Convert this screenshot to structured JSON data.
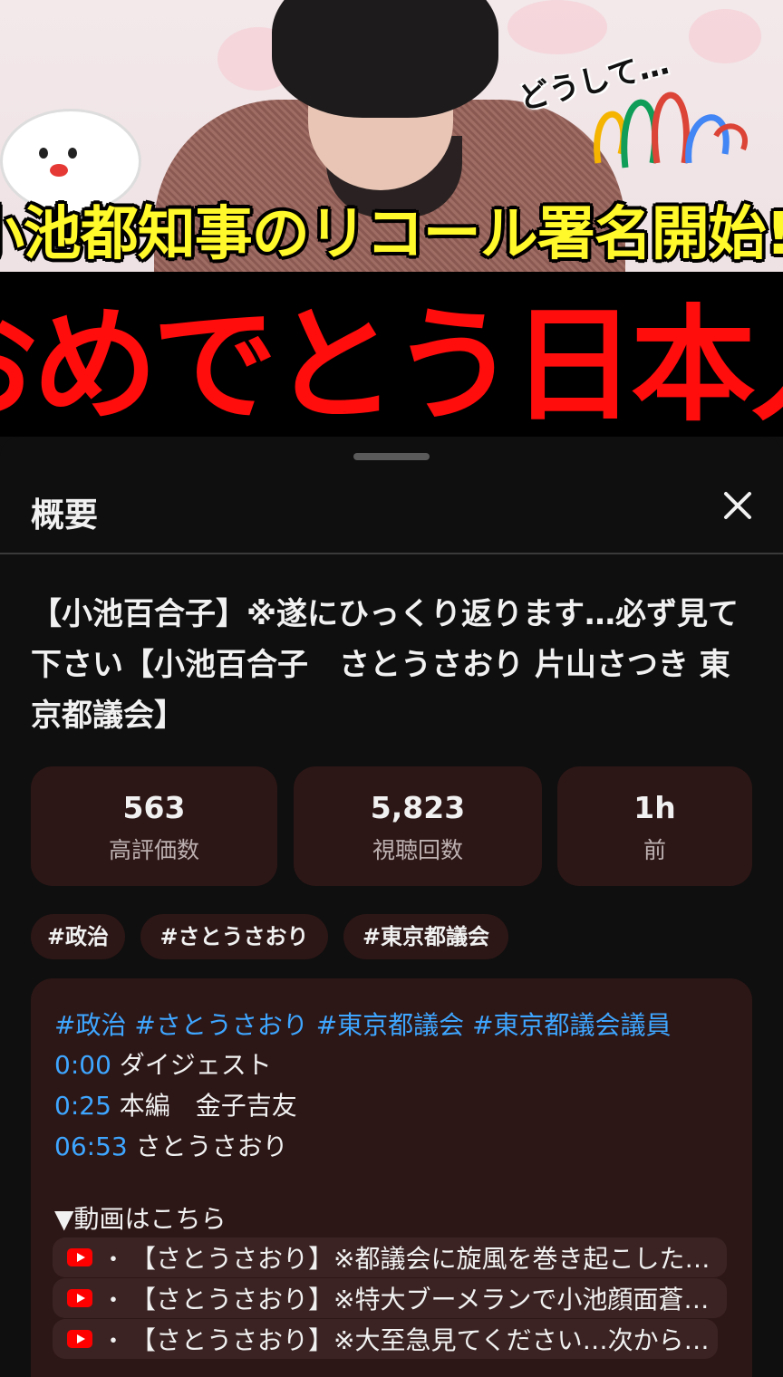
{
  "thumbnail": {
    "caption_top": "小池都知事のリコール署名開始!!",
    "caption_bottom": "おめでとう日本人",
    "bubble_text": "どうして…"
  },
  "sheet": {
    "title": "概要",
    "close_icon": "close-icon"
  },
  "video": {
    "title": "【小池百合子】※遂にひっくり返ります…必ず見て下さい【小池百合子　さとうさおり 片山さつき 東京都議会】"
  },
  "stats": [
    {
      "value": "563",
      "label": "高評価数"
    },
    {
      "value": "5,823",
      "label": "視聴回数"
    },
    {
      "value": "1h",
      "label": "前"
    }
  ],
  "tags": [
    "#政治",
    "#さとうさおり",
    "#東京都議会"
  ],
  "description": {
    "hashtags": "#政治 #さとうさおり #東京都議会 #東京都議会議員",
    "chapters": [
      {
        "time": "0:00",
        "text": "ダイジェスト"
      },
      {
        "time": "0:25",
        "text": "本編　金子吉友"
      },
      {
        "time": "06:53",
        "text": "さとうさおり"
      }
    ],
    "videos_header": "▼動画はこちら",
    "linked_videos": [
      {
        "icon": "youtube-icon",
        "text": "【さとうさおり】※都議会に旋風を巻き起こした…"
      },
      {
        "icon": "youtube-icon",
        "text": "【さとうさおり】※特大ブーメランで小池顔面蒼…"
      },
      {
        "icon": "youtube-icon",
        "text": "【さとうさおり】※大至急見てください…次から…"
      }
    ]
  },
  "colors": {
    "sheet_bg": "#0f0f0f",
    "card_bg": "#2d1616",
    "link": "#3ea6ff",
    "caption_yellow": "#fff82a",
    "caption_red": "#ff0c0c"
  }
}
